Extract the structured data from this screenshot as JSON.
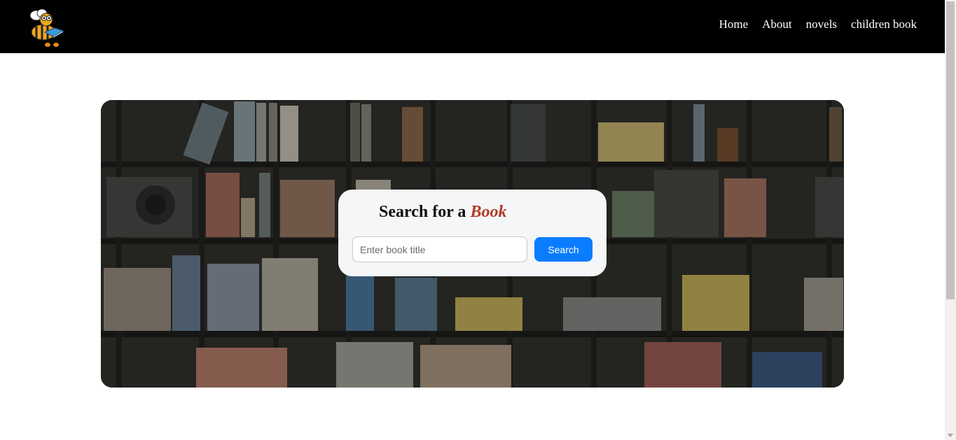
{
  "nav": {
    "logo_icon": "bee-reading-book-icon",
    "links": [
      {
        "label": "Home"
      },
      {
        "label": "About"
      },
      {
        "label": "novels"
      },
      {
        "label": "children book"
      }
    ]
  },
  "hero": {
    "background": "bookshelf-photo",
    "search": {
      "title_prefix": "Search for a",
      "title_accent": "Book",
      "input_placeholder": "Enter book title",
      "input_value": "",
      "button_label": "Search"
    }
  },
  "colors": {
    "navbar": "#000000",
    "accent": "#b33a25",
    "button": "#0a7cff",
    "card": "#f5f6f8"
  }
}
